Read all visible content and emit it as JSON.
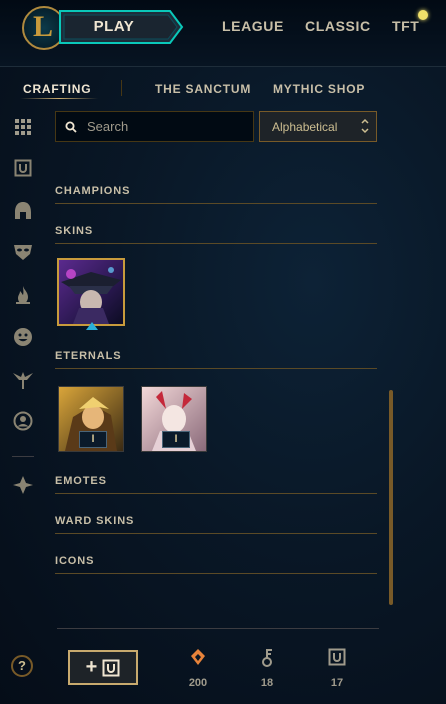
{
  "header": {
    "play_label": "PLAY",
    "modes": [
      "LEAGUE",
      "CLASSIC",
      "TFT"
    ]
  },
  "tabs": [
    {
      "label": "CRAFTING",
      "active": true
    },
    {
      "label": "THE SANCTUM",
      "active": false
    },
    {
      "label": "MYTHIC SHOP",
      "active": false
    }
  ],
  "sidebar_icons": [
    "grid-icon",
    "chest-icon",
    "helmet-icon",
    "mask-icon",
    "flame-icon",
    "emote-icon",
    "ward-icon",
    "profile-icon",
    "crest-icon"
  ],
  "search": {
    "placeholder": "Search",
    "value": ""
  },
  "sort": {
    "selected": "Alphabetical"
  },
  "sections": {
    "champions": "CHAMPIONS",
    "skins": "SKINS",
    "eternals": "ETERNALS",
    "emotes": "EMOTES",
    "ward_skins": "WARD SKINS",
    "icons": "ICONS"
  },
  "eternals": [
    {
      "badge": "I"
    },
    {
      "badge": "I"
    }
  ],
  "footer": {
    "help": "?",
    "add_label": "+",
    "currencies": [
      {
        "name": "orange-essence-icon",
        "value": "200",
        "color": "#e8833a"
      },
      {
        "name": "key-fragment-icon",
        "value": "18",
        "color": "#a09b8c"
      },
      {
        "name": "chest-icon",
        "value": "17",
        "color": "#a09b8c"
      }
    ]
  },
  "colors": {
    "gold": "#c89b3c",
    "accent_blue": "#0ac8b9",
    "text": "#a09b8c"
  }
}
